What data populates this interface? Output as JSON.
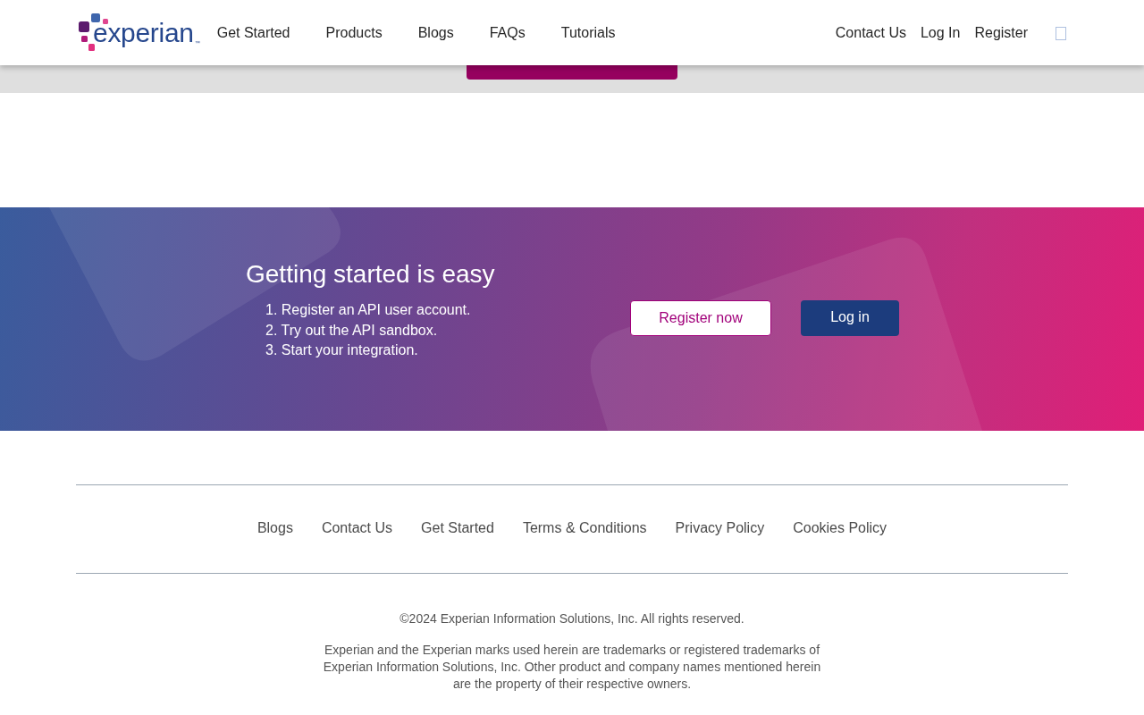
{
  "header": {
    "logo": {
      "wordmark": "experian",
      "trademark": "™"
    },
    "nav_left": [
      "Get Started",
      "Products",
      "Blogs",
      "FAQs",
      "Tutorials"
    ],
    "nav_right": [
      "Contact Us",
      "Log In",
      "Register"
    ]
  },
  "banner": {
    "heading": "Getting started is easy",
    "steps": [
      "1. Register an API user account.",
      "2. Try out the API sandbox.",
      "3. Start your integration."
    ],
    "buttons": [
      {
        "label": "Register now",
        "kind": "outline"
      },
      {
        "label": "Log in",
        "kind": "solid"
      }
    ]
  },
  "footer": {
    "links": [
      "Blogs",
      "Contact Us",
      "Get Started",
      "Terms & Conditions",
      "Privacy Policy",
      "Cookies Policy"
    ],
    "copyright": "©2024 Experian Information Solutions, Inc. All rights reserved.",
    "legal": "Experian and the Experian marks used herein are trademarks or registered trademarks of Experian Information Solutions, Inc. Other product and company names mentioned herein are the property of their respective owners."
  }
}
